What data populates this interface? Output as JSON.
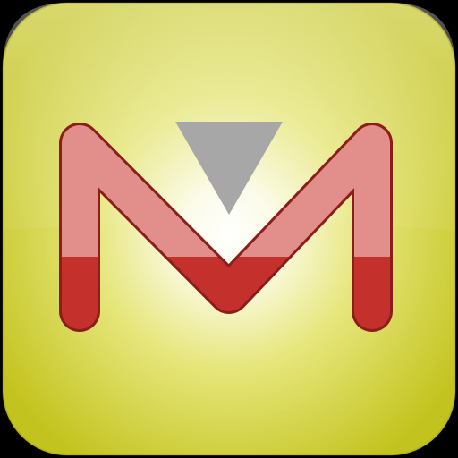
{
  "icon": {
    "name": "app-icon",
    "logo_letter": "M",
    "colors": {
      "background_dark": "#c3c31f",
      "background_mid": "#dede5a",
      "background_light": "#f7f7d9",
      "glow_center": "#ffffff",
      "letter_red": "#c4302b",
      "letter_pink": "#e28f8c",
      "letter_outline": "#8c1e1a",
      "triangle_gray": "#a7a7a7",
      "corner_bg": "#000000"
    }
  }
}
